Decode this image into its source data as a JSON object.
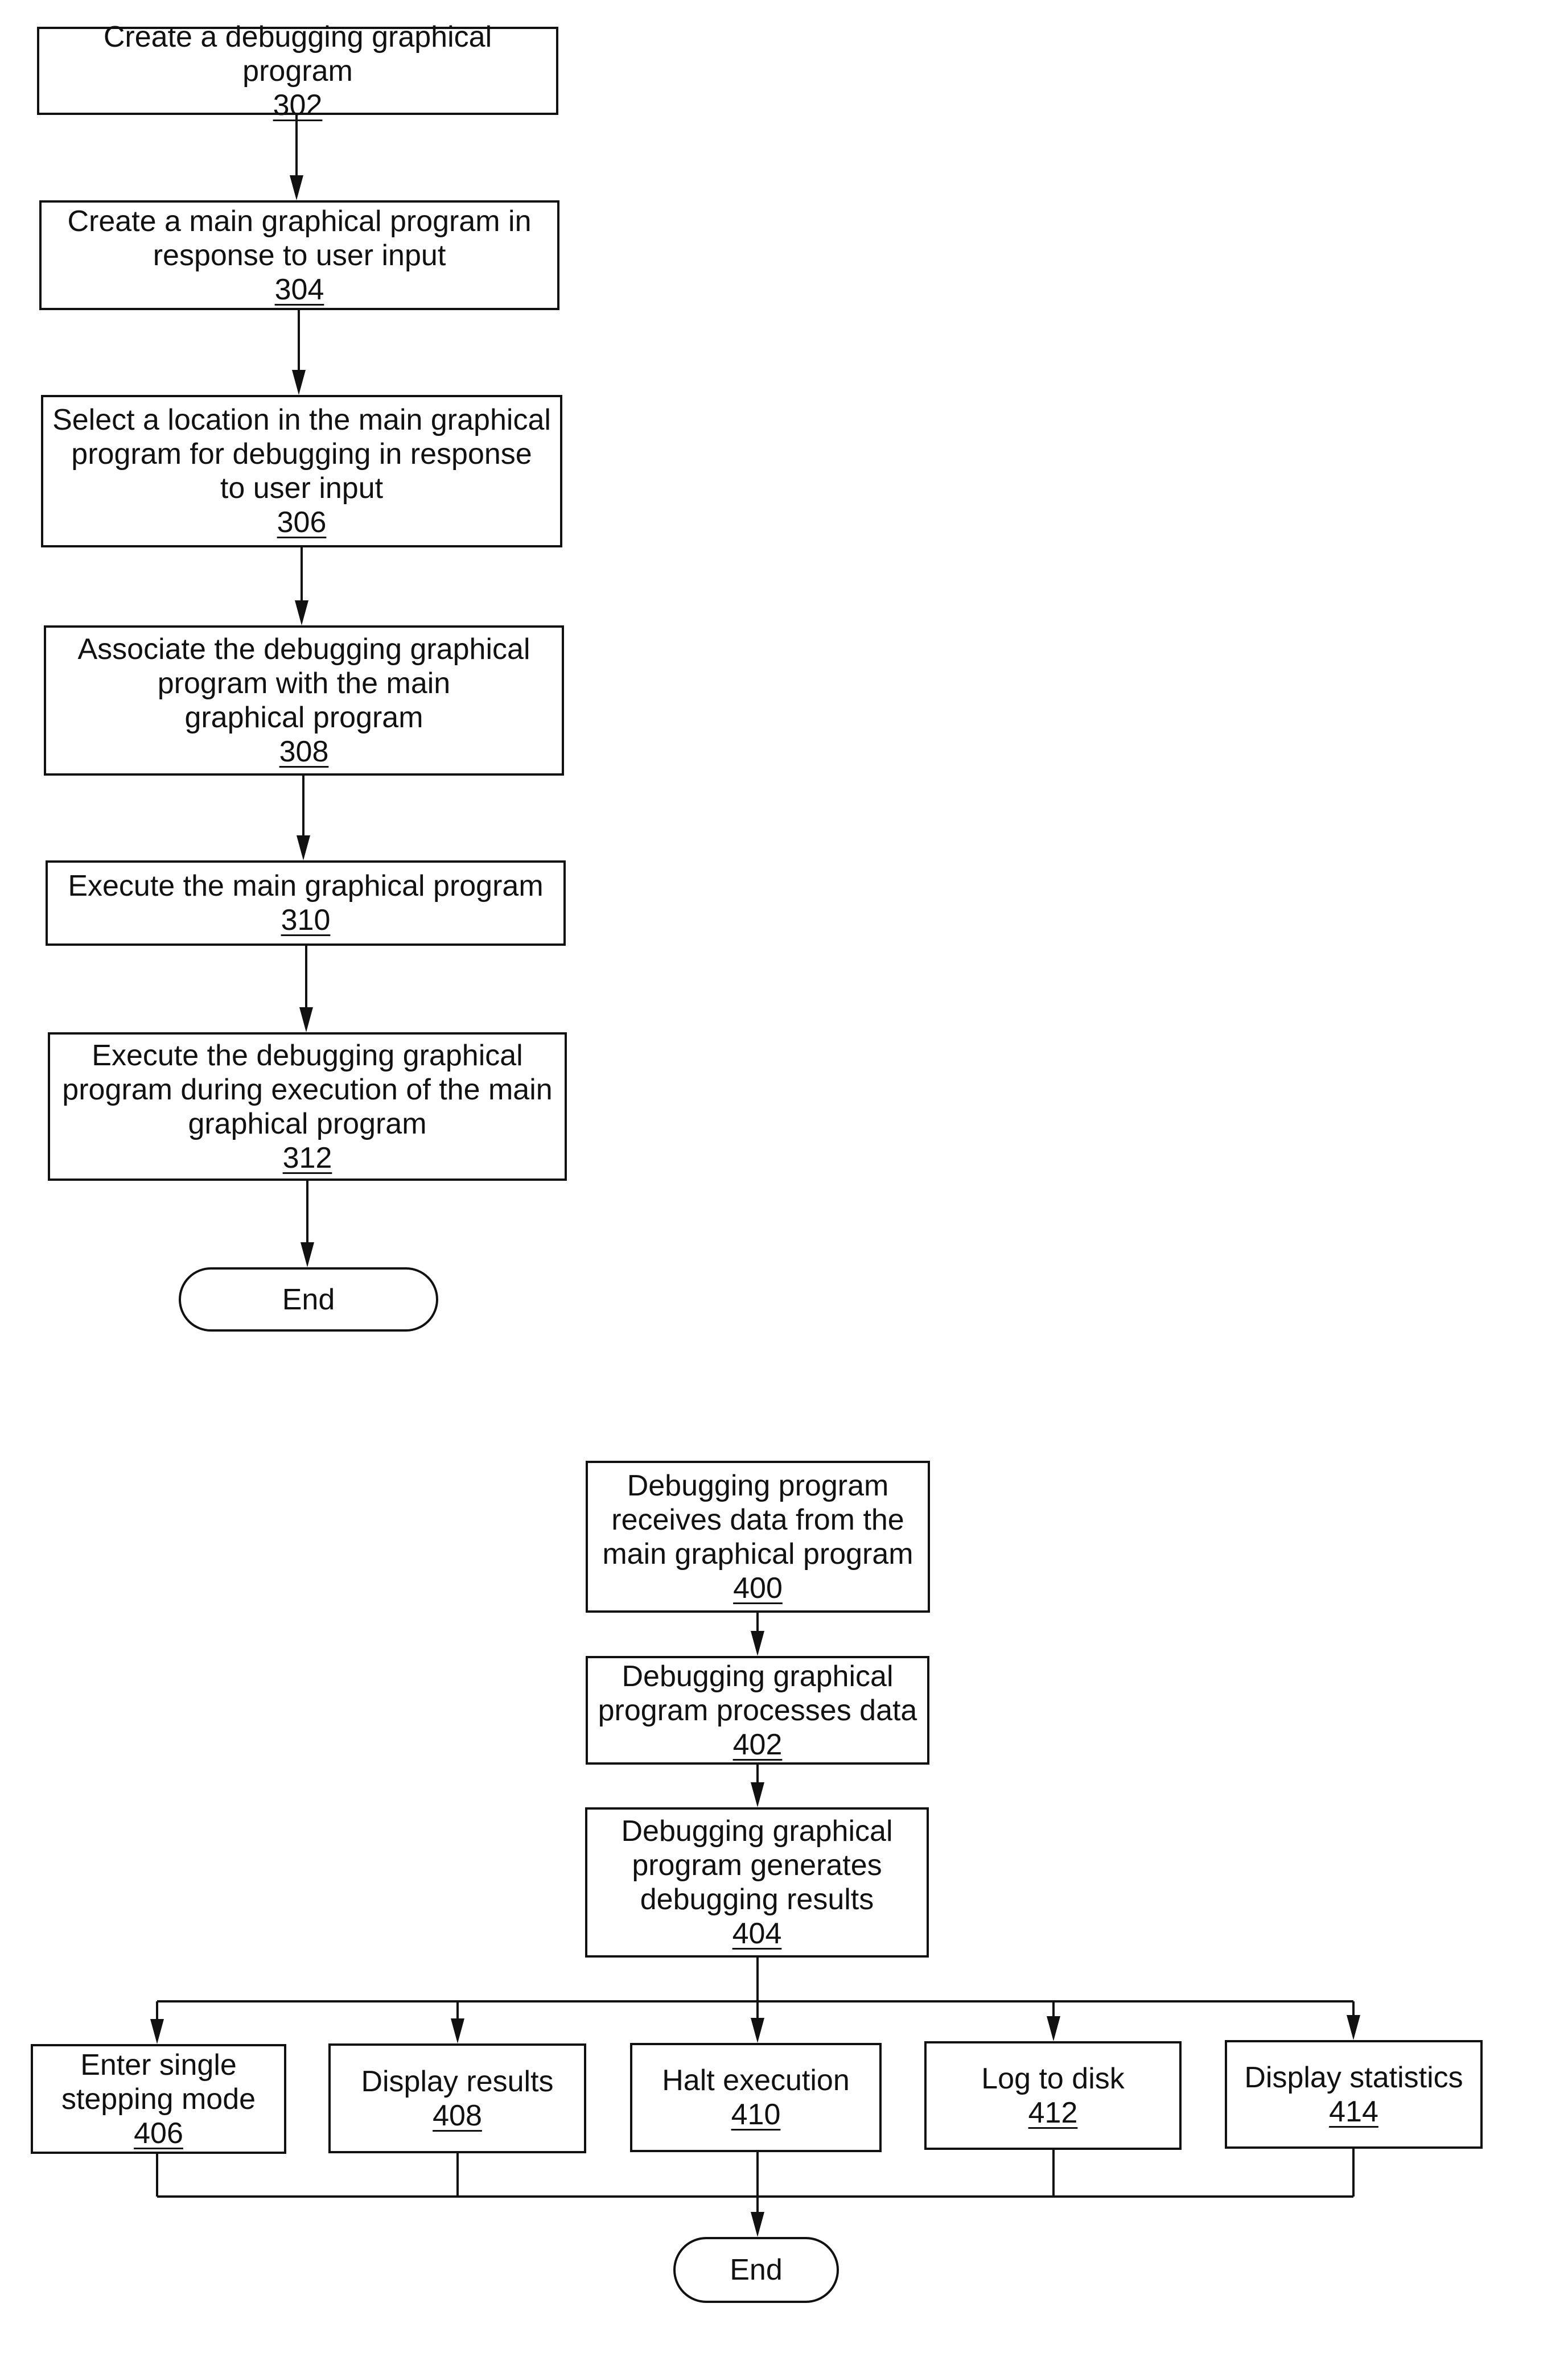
{
  "figure_top": {
    "steps": [
      {
        "id": "302",
        "lines": [
          "Create a debugging graphical program"
        ],
        "number": "302"
      },
      {
        "id": "304",
        "lines": [
          "Create a main graphical program in",
          "response to user input"
        ],
        "number": "304"
      },
      {
        "id": "306",
        "lines": [
          "Select a location in the main graphical",
          "program for debugging in response",
          "to user input"
        ],
        "number": "306"
      },
      {
        "id": "308",
        "lines": [
          "Associate the debugging graphical",
          "program with the main",
          "graphical program"
        ],
        "number": "308"
      },
      {
        "id": "310",
        "lines": [
          "Execute the main graphical program"
        ],
        "number": "310"
      },
      {
        "id": "312",
        "lines": [
          "Execute the debugging graphical",
          "program during execution of the main",
          "graphical program"
        ],
        "number": "312"
      }
    ],
    "end_label": "End"
  },
  "figure_bottom": {
    "steps": [
      {
        "id": "400",
        "lines": [
          "Debugging program",
          "receives data from the",
          "main graphical program"
        ],
        "number": "400"
      },
      {
        "id": "402",
        "lines": [
          "Debugging graphical",
          "program processes data"
        ],
        "number": "402"
      },
      {
        "id": "404",
        "lines": [
          "Debugging graphical",
          "program generates",
          "debugging results"
        ],
        "number": "404"
      }
    ],
    "branches": [
      {
        "id": "406",
        "lines": [
          "Enter single",
          "stepping mode"
        ],
        "number": "406"
      },
      {
        "id": "408",
        "lines": [
          "Display results"
        ],
        "number": "408"
      },
      {
        "id": "410",
        "lines": [
          "Halt execution"
        ],
        "number": "410"
      },
      {
        "id": "412",
        "lines": [
          "Log to disk"
        ],
        "number": "412"
      },
      {
        "id": "414",
        "lines": [
          "Display statistics"
        ],
        "number": "414"
      }
    ],
    "end_label": "End"
  }
}
